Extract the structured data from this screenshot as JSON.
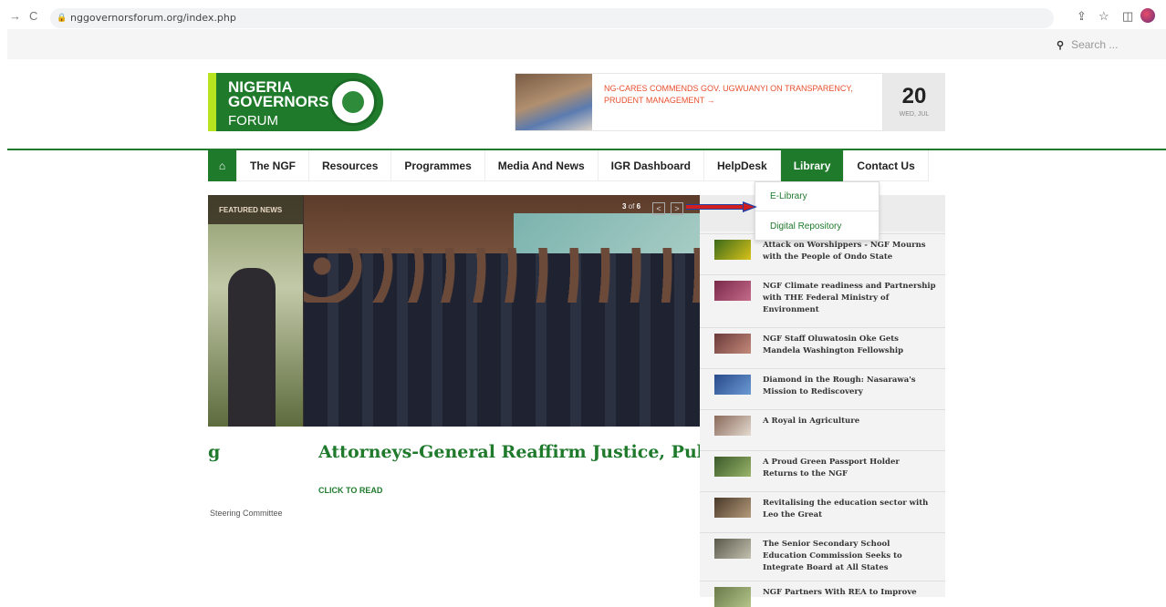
{
  "browser": {
    "url": "nggovernorsforum.org/index.php",
    "back_icon": "back-arrow-icon",
    "reload_icon": "reload-icon"
  },
  "topbar": {
    "search_placeholder": "Search ...",
    "search_icon": "search-icon"
  },
  "logo": {
    "line1": "NIGERIA",
    "line2": "GOVERNORS'",
    "line3": "FORUM"
  },
  "ticker": {
    "text": "NG-CARES COMMENDS GOV. UGWUANYI ON TRANSPARENCY, PRUDENT MANAGEMENT →"
  },
  "date": {
    "day": "20",
    "weekday_month": "WED, JUL"
  },
  "nav": {
    "home_icon": "home-icon",
    "items": [
      "The NGF",
      "Resources",
      "Programmes",
      "Media And News",
      "IGR Dashboard",
      "HelpDesk",
      "Library",
      "Contact Us"
    ],
    "active": "Library"
  },
  "library_dropdown": {
    "options": [
      "E-Library",
      "Digital Repository"
    ]
  },
  "featured": {
    "tag": "FEATURED NEWS",
    "counter_current": "3",
    "counter_sep": "of",
    "counter_total": "6",
    "prev_label": "<",
    "next_label": ">",
    "headline": "Attorneys-General Reaffirm Justice, Public In",
    "prev_headline_fragment": "g",
    "cta": "CLICK TO READ",
    "prev_excerpt_fragment": "Steering Committee"
  },
  "news_list": [
    "Attack on Worshippers - NGF Mourns with the People of Ondo State",
    "NGF Climate readiness and Partnership with THE Federal Ministry of Environment",
    "NGF Staff Oluwatosin Oke Gets Mandela Washington Fellowship",
    "Diamond in the Rough: Nasarawa's Mission to Rediscovery",
    "A Royal in Agriculture",
    "A Proud Green Passport Holder Returns to the NGF",
    "Revitalising the education sector with Leo the Great",
    "The Senior Secondary School Education Commission Seeks to Integrate Board at All States",
    "NGF Partners With REA to Improve"
  ],
  "colors": {
    "brand_green": "#1f7a2c",
    "accent_lime": "#b7e41e",
    "ticker_orange": "#e8502f",
    "annotation_arrow": "#d11f1f"
  }
}
